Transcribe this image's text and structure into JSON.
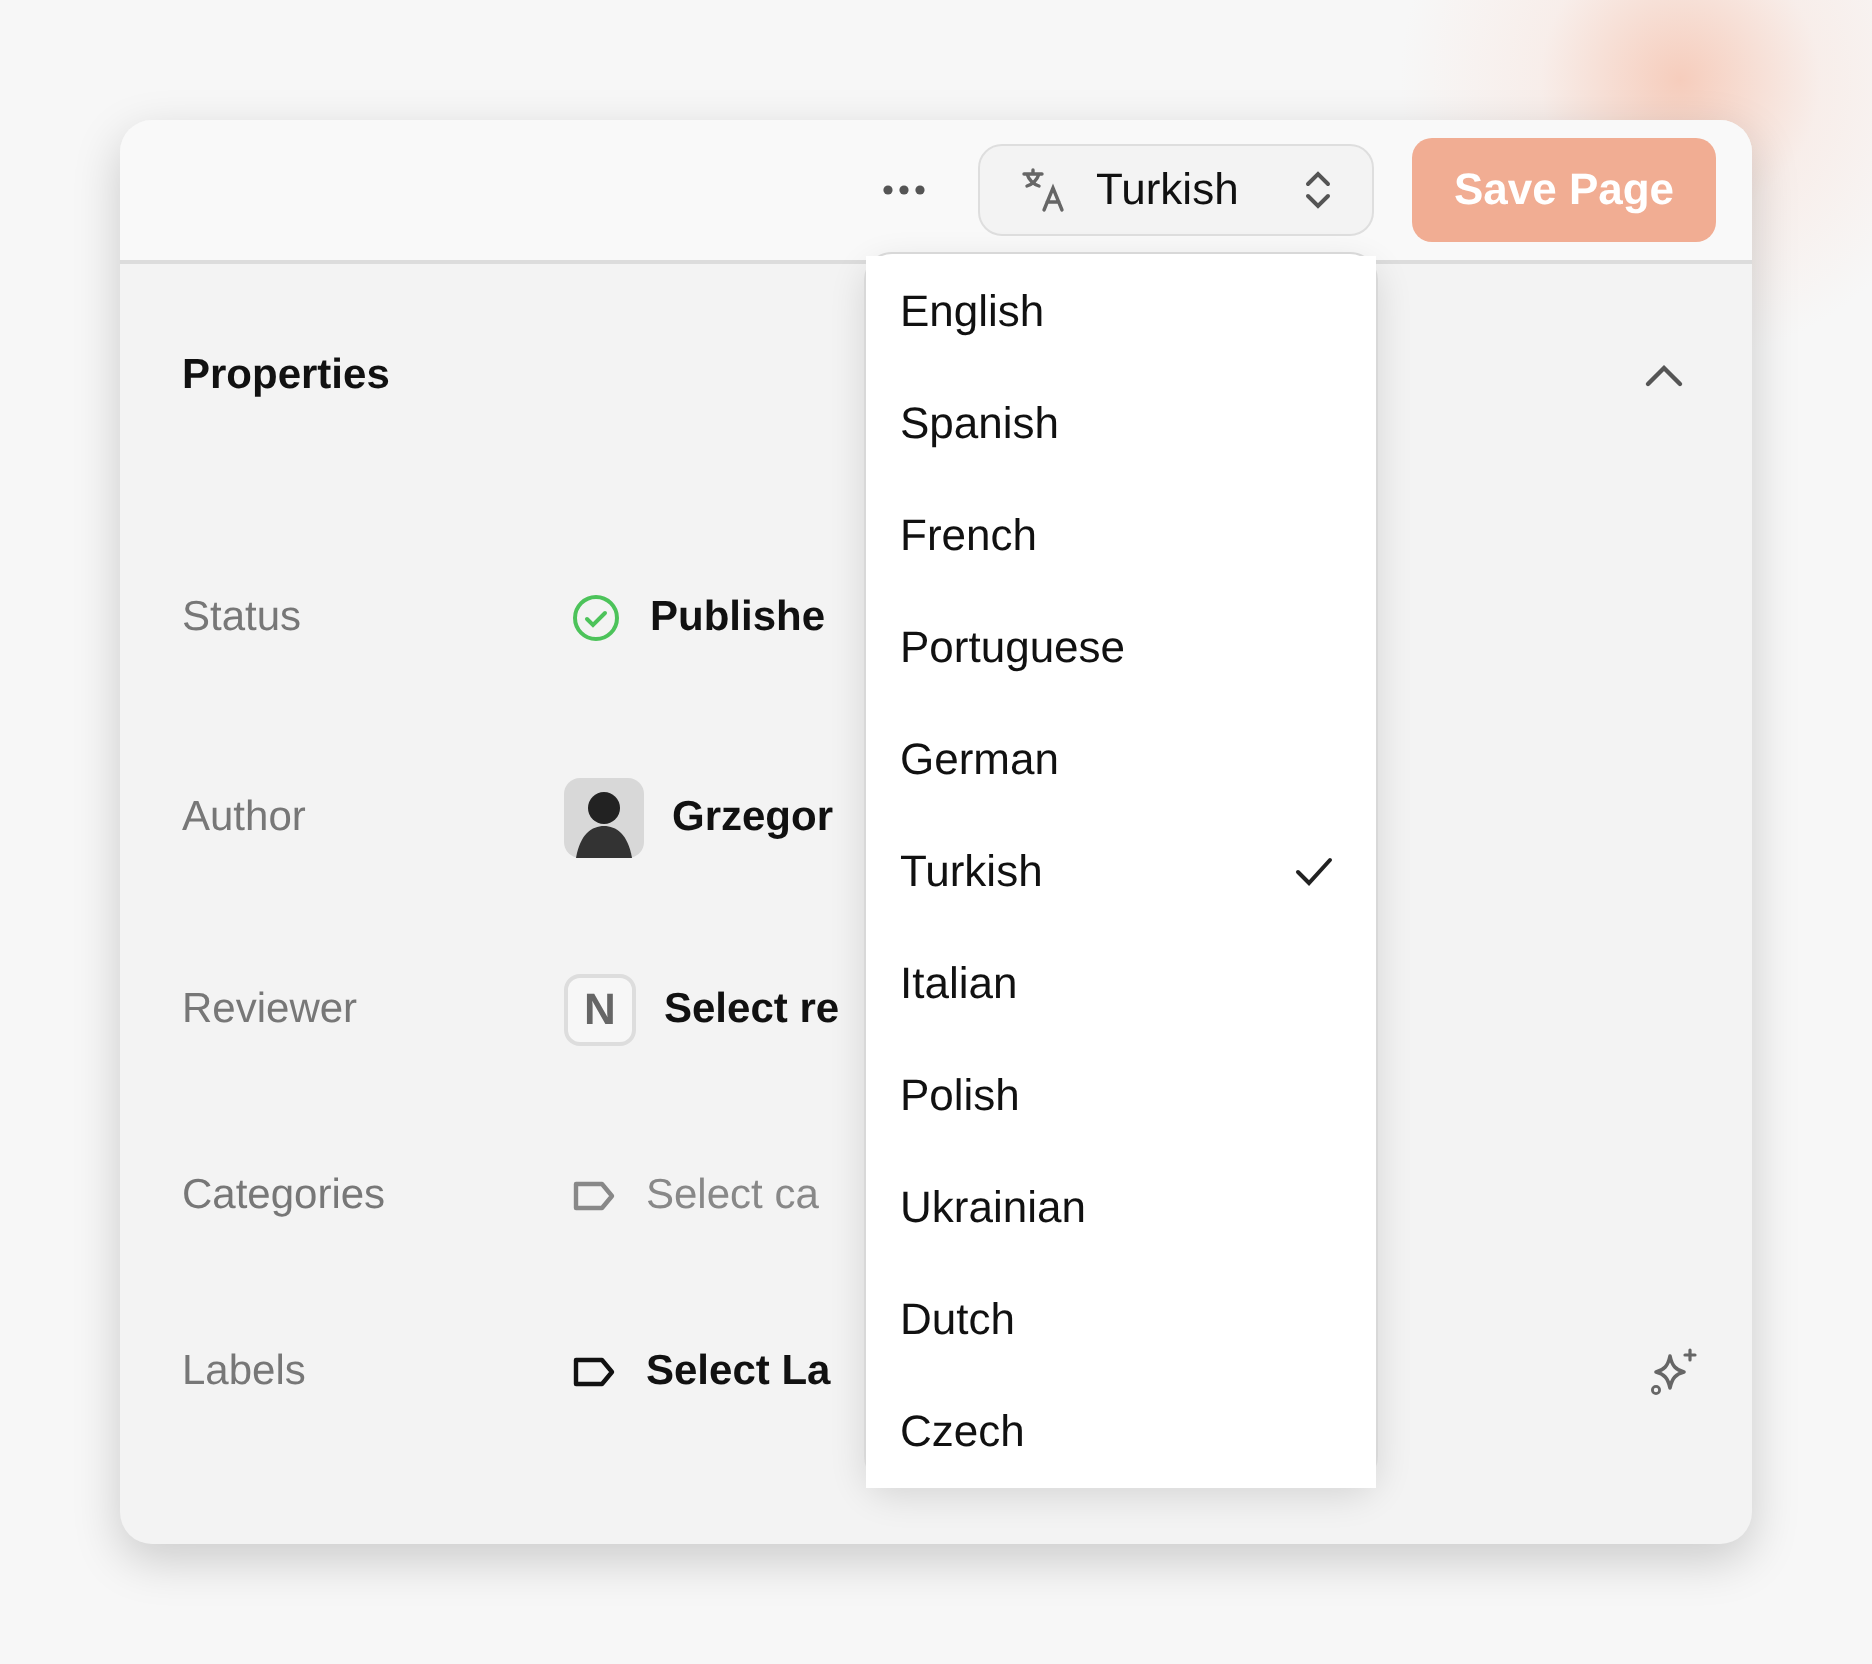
{
  "toolbar": {
    "language_selector": {
      "value": "Turkish"
    },
    "save_button": {
      "label": "Save Page",
      "disabled": true
    }
  },
  "properties": {
    "title": "Properties",
    "expanded": true,
    "rows": [
      {
        "label": "Status",
        "kind": "status",
        "value": "Publishe",
        "muted": false
      },
      {
        "label": "Author",
        "kind": "person",
        "value": "Grzegor",
        "muted": false
      },
      {
        "label": "Reviewer",
        "kind": "initial",
        "initial": "N",
        "value": "Select re",
        "muted": false
      },
      {
        "label": "Categories",
        "kind": "tag",
        "value": "Select ca",
        "muted": true
      },
      {
        "label": "Labels",
        "kind": "tag",
        "value": "Select La",
        "muted": false,
        "sparkle": true
      }
    ]
  },
  "language_menu": {
    "open": true,
    "options": [
      {
        "label": "English",
        "selected": false
      },
      {
        "label": "Spanish",
        "selected": false
      },
      {
        "label": "French",
        "selected": false
      },
      {
        "label": "Portuguese",
        "selected": false
      },
      {
        "label": "German",
        "selected": false
      },
      {
        "label": "Turkish",
        "selected": true
      },
      {
        "label": "Italian",
        "selected": false
      },
      {
        "label": "Polish",
        "selected": false
      },
      {
        "label": "Ukrainian",
        "selected": false
      },
      {
        "label": "Dutch",
        "selected": false
      },
      {
        "label": "Czech",
        "selected": false
      }
    ]
  }
}
